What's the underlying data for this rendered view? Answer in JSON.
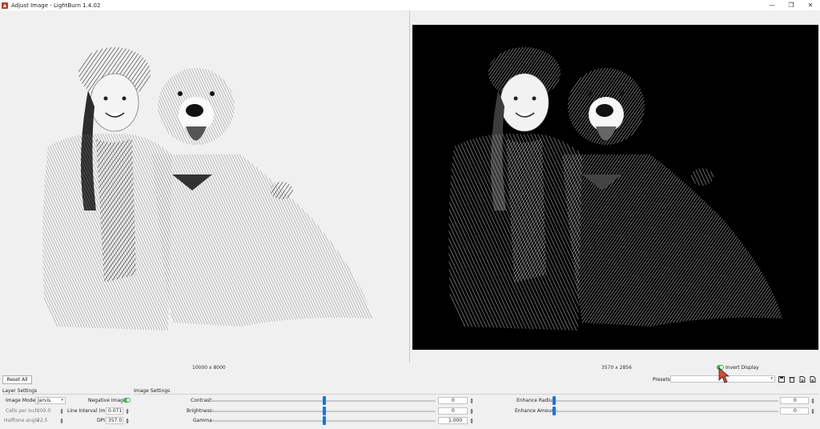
{
  "window": {
    "title": "Adjust Image - LightBurn 1.4.02",
    "controls": {
      "minimize": "—",
      "restore": "❐",
      "close": "✕"
    }
  },
  "left_pane": {
    "dimensions": "10000 x 8000"
  },
  "right_pane": {
    "dimensions": "3570 x 2856",
    "invert_display_label": "Invert Display",
    "invert_display_on": true
  },
  "toolbar": {
    "reset_all": "Reset All",
    "presets_label": "Presets:",
    "presets_value": ""
  },
  "layer_settings": {
    "title": "Layer Settings",
    "image_mode_label": "Image Mode:",
    "image_mode_value": "Jarvis",
    "negative_image_label": "Negative Image",
    "negative_image_on": true,
    "cells_per_inch_label": "Cells per inch",
    "cells_per_inch_value": "200.0",
    "line_interval_label": "Line Interval (mm)",
    "line_interval_value": "0.071",
    "halftone_angle_label": "Halftone angle",
    "halftone_angle_value": "22.5",
    "dpi_label": "DPI",
    "dpi_value": "357.0"
  },
  "image_settings": {
    "title": "Image Settings",
    "contrast_label": "Contrast:",
    "contrast_value": "0",
    "brightness_label": "Brightness:",
    "brightness_value": "0",
    "gamma_label": "Gamma:",
    "gamma_value": "1.000",
    "enhance_radius_label": "Enhance Radius:",
    "enhance_radius_value": "0",
    "enhance_amount_label": "Enhance Amount:",
    "enhance_amount_value": "0"
  },
  "colors": {
    "accent": "#1e74d6",
    "toggle_on": "#39b54a",
    "preview_bg": "#000000",
    "cursor": "#d94a2a"
  }
}
